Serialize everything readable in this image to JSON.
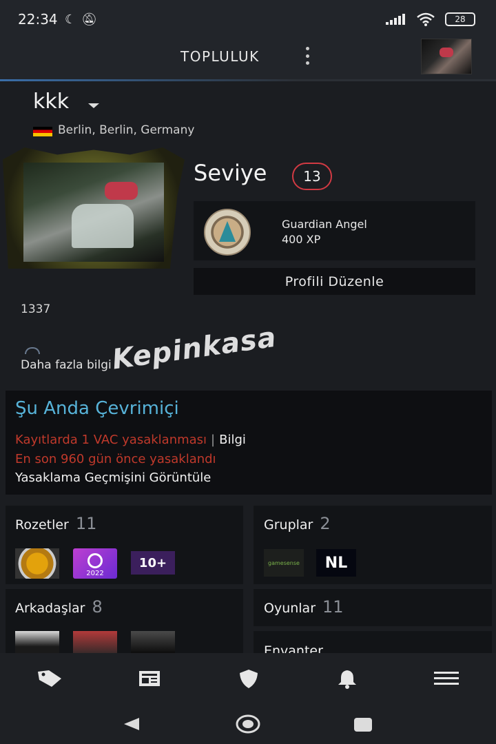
{
  "status_bar": {
    "time": "22:34",
    "battery": "28"
  },
  "header": {
    "title": "TOPLULUK"
  },
  "profile": {
    "username": "kkk",
    "location": "Berlin, Berlin, Germany",
    "level_label": "Seviye",
    "level": "13",
    "xp_badge_name": "Guardian Angel",
    "xp": "400 XP",
    "edit_button": "Profili Düzenle",
    "summary": "1337",
    "more_info": "Daha fazla bilgi",
    "watermark": "Kepinkasa"
  },
  "status": {
    "online": "Şu Anda Çevrimiçi",
    "vac_line": "Kayıtlarda 1 VAC yasaklanması",
    "vac_separator": "|",
    "vac_info": "Bilgi",
    "last_ban": "En son 960 gün önce yasaklandı",
    "ban_history": "Yasaklama Geçmişini Görüntüle"
  },
  "cards": {
    "badges": {
      "title": "Rozetler",
      "count": "11",
      "steam_badge_year": "2022",
      "level_badge": "10+"
    },
    "groups": {
      "title": "Gruplar",
      "count": "2",
      "group1": "gamesense",
      "group2": "NL"
    },
    "friends": {
      "title": "Arkadaşlar",
      "count": "8"
    },
    "games": {
      "title": "Oyunlar",
      "count": "11"
    },
    "inventory": {
      "title": "Envanter"
    }
  },
  "icons": {
    "nav": [
      "tag-icon",
      "news-icon",
      "shield-icon",
      "bell-icon",
      "menu-icon"
    ],
    "system": [
      "back-icon",
      "home-icon",
      "recents-icon"
    ]
  },
  "colors": {
    "online": "#57b3d9",
    "vac": "#c0392b",
    "level_ring": "#d23a43",
    "background": "#1b1d21"
  }
}
